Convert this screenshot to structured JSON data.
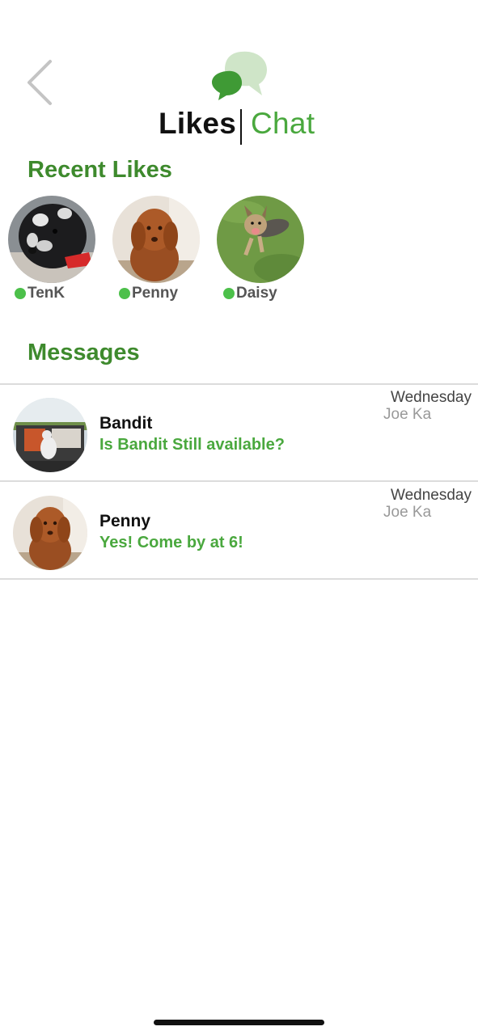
{
  "header": {
    "back_icon": "chevron-left-icon",
    "logo_icon": "chat-bubbles-icon",
    "tabs": [
      {
        "label": "Likes",
        "active": false
      },
      {
        "label": "Chat",
        "active": true
      }
    ]
  },
  "recent_likes": {
    "title": "Recent Likes",
    "items": [
      {
        "name": "TenK",
        "online": true
      },
      {
        "name": "Penny",
        "online": true
      },
      {
        "name": "Daisy",
        "online": true
      }
    ]
  },
  "messages": {
    "title": "Messages",
    "items": [
      {
        "name": "Bandit",
        "preview": "Is Bandit Still available?",
        "day": "Wednesday",
        "sender": "Joe Ka"
      },
      {
        "name": "Penny",
        "preview": "Yes! Come by at 6!",
        "day": "Wednesday",
        "sender": "Joe Ka"
      }
    ]
  },
  "colors": {
    "accent_green": "#4aa83e",
    "title_green": "#3e8a2d",
    "online_dot": "#4cc04a"
  }
}
